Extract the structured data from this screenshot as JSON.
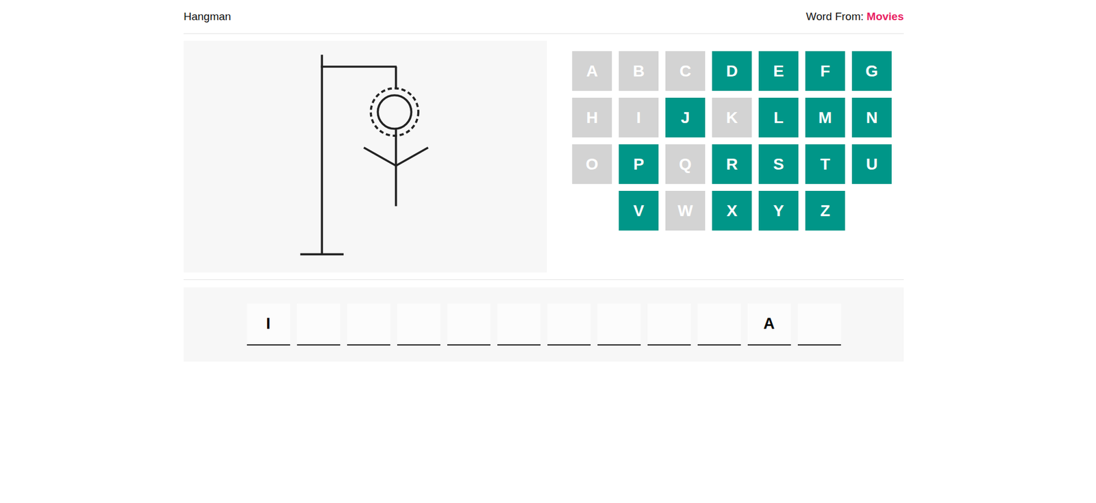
{
  "header": {
    "title": "Hangman",
    "source_label": "Word From: ",
    "category": "Movies"
  },
  "gallows": {
    "parts": [
      {
        "name": "head",
        "shown": true
      },
      {
        "name": "body",
        "shown": true
      },
      {
        "name": "left-arm",
        "shown": true
      },
      {
        "name": "right-arm",
        "shown": true
      },
      {
        "name": "left-leg",
        "shown": false
      },
      {
        "name": "right-leg",
        "shown": false
      }
    ]
  },
  "keyboard": {
    "rows": [
      [
        {
          "letter": "A",
          "used": true
        },
        {
          "letter": "B",
          "used": true
        },
        {
          "letter": "C",
          "used": true
        },
        {
          "letter": "D",
          "used": false
        },
        {
          "letter": "E",
          "used": false
        },
        {
          "letter": "F",
          "used": false
        },
        {
          "letter": "G",
          "used": false
        }
      ],
      [
        {
          "letter": "H",
          "used": true
        },
        {
          "letter": "I",
          "used": true
        },
        {
          "letter": "J",
          "used": false
        },
        {
          "letter": "K",
          "used": true
        },
        {
          "letter": "L",
          "used": false
        },
        {
          "letter": "M",
          "used": false
        },
        {
          "letter": "N",
          "used": false
        }
      ],
      [
        {
          "letter": "O",
          "used": true
        },
        {
          "letter": "P",
          "used": false
        },
        {
          "letter": "Q",
          "used": true
        },
        {
          "letter": "R",
          "used": false
        },
        {
          "letter": "S",
          "used": false
        },
        {
          "letter": "T",
          "used": false
        },
        {
          "letter": "U",
          "used": false
        }
      ],
      [
        {
          "letter": "V",
          "used": false
        },
        {
          "letter": "W",
          "used": true
        },
        {
          "letter": "X",
          "used": false
        },
        {
          "letter": "Y",
          "used": false
        },
        {
          "letter": "Z",
          "used": false
        }
      ]
    ]
  },
  "word": {
    "slots": [
      "I",
      "",
      "",
      "",
      "",
      "",
      "",
      "",
      "",
      "",
      "A",
      ""
    ]
  }
}
